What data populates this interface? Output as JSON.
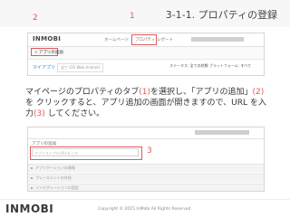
{
  "slide": {
    "title": "3-1-1. プロパティの登録",
    "instruction": {
      "before": "マイページのプロパティのタブ",
      "ref1": "(1)",
      "mid1": "を選択し、「アプリの追加」",
      "ref2": "(2)",
      "mid2": "を クリックすると、アプリ追加の画面が開きますので、URL を入力",
      "ref3": "(3)",
      "after": " してください。"
    }
  },
  "screenshot1": {
    "logo": "INMOBI",
    "nav": [
      "ホームページ",
      "プロパティ",
      "レポート"
    ],
    "email": "xxxxxxxx@inmobi.com",
    "add_app_label": "アプリの追加",
    "my_apps": "マイアプリ",
    "tabs": "全て  iOS  Web  Android",
    "filter_label": "ステータス:",
    "filter_value": "全ての状態",
    "view_label": "プラットフォーム:",
    "view_value": "すべて",
    "marker1": "1",
    "marker2": "2"
  },
  "screenshot2": {
    "email": "xxxxxxxx@inmobi.com",
    "panel_title": "アプリの追加",
    "url_placeholder": "アプリストアのURLを入力",
    "sections": [
      "アプリケーションの情報",
      "プレースメントの作成",
      "インテグレーションの設定"
    ],
    "marker3": "3"
  },
  "footer": {
    "logo": "INMOBI",
    "copyright": "Copyright © 2015 InMobi All Rights Reserved."
  },
  "colors": {
    "highlight": "#e05a5a",
    "link": "#2e8bc9"
  }
}
